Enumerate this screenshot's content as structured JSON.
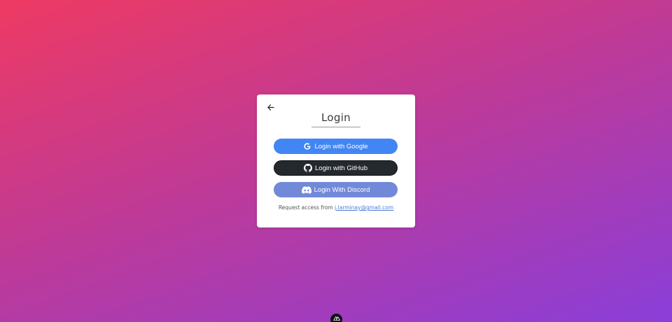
{
  "card": {
    "back_icon": "arrow-left-icon",
    "title": "Login"
  },
  "buttons": {
    "google": {
      "label": "Login with Google",
      "icon": "google-icon",
      "color": "#4285f4"
    },
    "github": {
      "label": "Login with GitHub",
      "icon": "github-icon",
      "color": "#24292e"
    },
    "discord": {
      "label": "Login With Discord",
      "icon": "discord-icon",
      "color": "#7289da"
    }
  },
  "request": {
    "prefix": "Request access from",
    "email": "j.larminay@gmail.com"
  },
  "devtools_badge": {
    "icon": "nuxt-devtools-icon"
  },
  "theme": {
    "gradient_start": "#ee3a63",
    "gradient_end": "#8a3ed9"
  }
}
